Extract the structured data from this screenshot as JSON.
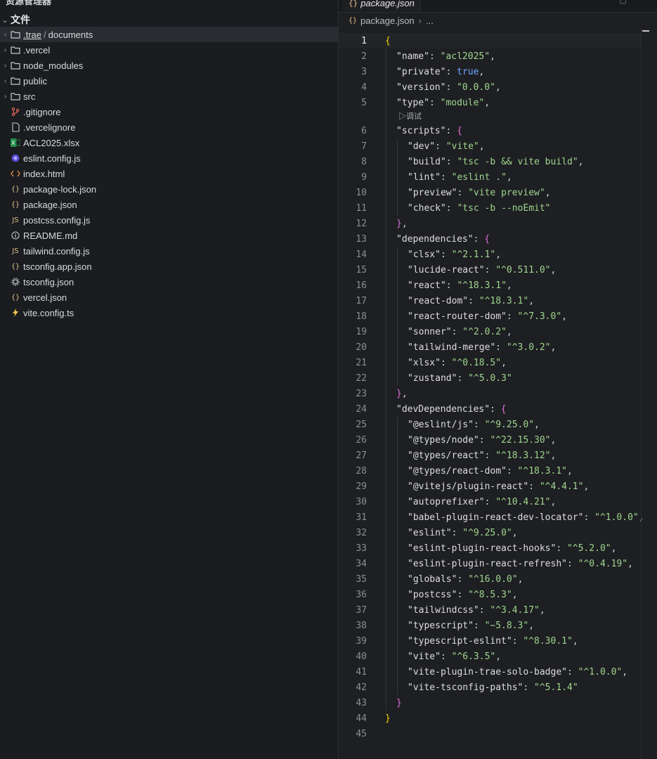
{
  "sidebar": {
    "header": "资源管理器",
    "section_label": "文件",
    "items": [
      {
        "kind": "folder",
        "name": ".trae",
        "sub": "documents",
        "icon": "folder-icon",
        "selected": true
      },
      {
        "kind": "folder",
        "name": ".vercel",
        "icon": "folder-icon"
      },
      {
        "kind": "folder",
        "name": "node_modules",
        "icon": "folder-icon"
      },
      {
        "kind": "folder",
        "name": "public",
        "icon": "folder-icon"
      },
      {
        "kind": "folder",
        "name": "src",
        "icon": "folder-icon"
      },
      {
        "kind": "file",
        "name": ".gitignore",
        "icon": "git-icon"
      },
      {
        "kind": "file",
        "name": ".vercelignore",
        "icon": "file-icon"
      },
      {
        "kind": "file",
        "name": "ACL2025.xlsx",
        "icon": "excel-icon"
      },
      {
        "kind": "file",
        "name": "eslint.config.js",
        "icon": "eslint-icon"
      },
      {
        "kind": "file",
        "name": "index.html",
        "icon": "html-icon"
      },
      {
        "kind": "file",
        "name": "package-lock.json",
        "icon": "json-icon"
      },
      {
        "kind": "file",
        "name": "package.json",
        "icon": "json-icon"
      },
      {
        "kind": "file",
        "name": "postcss.config.js",
        "icon": "js-icon"
      },
      {
        "kind": "file",
        "name": "README.md",
        "icon": "info-icon"
      },
      {
        "kind": "file",
        "name": "tailwind.config.js",
        "icon": "js-icon"
      },
      {
        "kind": "file",
        "name": "tsconfig.app.json",
        "icon": "json-icon"
      },
      {
        "kind": "file",
        "name": "tsconfig.json",
        "icon": "gear-icon"
      },
      {
        "kind": "file",
        "name": "vercel.json",
        "icon": "json-icon"
      },
      {
        "kind": "file",
        "name": "vite.config.ts",
        "icon": "vite-icon"
      }
    ]
  },
  "editor": {
    "tab_label": "package.json",
    "breadcrumb": {
      "file": "package.json",
      "rest": "..."
    },
    "codelens": "▷调试",
    "current_line": 1,
    "lines": [
      {
        "n": "1",
        "tokens": [
          [
            "b1",
            "{"
          ]
        ],
        "indent": 0
      },
      {
        "n": "2",
        "tokens": [
          [
            "k",
            "\"name\""
          ],
          [
            "p",
            ": "
          ],
          [
            "s",
            "\"acl2025\""
          ],
          [
            "p",
            ","
          ]
        ],
        "indent": 1
      },
      {
        "n": "3",
        "tokens": [
          [
            "k",
            "\"private\""
          ],
          [
            "p",
            ": "
          ],
          [
            "lit",
            "true"
          ],
          [
            "p",
            ","
          ]
        ],
        "indent": 1
      },
      {
        "n": "4",
        "tokens": [
          [
            "k",
            "\"version\""
          ],
          [
            "p",
            ": "
          ],
          [
            "s",
            "\"0.0.0\""
          ],
          [
            "p",
            ","
          ]
        ],
        "indent": 1
      },
      {
        "n": "5",
        "tokens": [
          [
            "k",
            "\"type\""
          ],
          [
            "p",
            ": "
          ],
          [
            "s",
            "\"module\""
          ],
          [
            "p",
            ","
          ]
        ],
        "indent": 1
      },
      {
        "n": "6",
        "tokens": [
          [
            "k",
            "\"scripts\""
          ],
          [
            "p",
            ": "
          ],
          [
            "b2",
            "{"
          ]
        ],
        "indent": 1
      },
      {
        "n": "7",
        "tokens": [
          [
            "k",
            "\"dev\""
          ],
          [
            "p",
            ": "
          ],
          [
            "s",
            "\"vite\""
          ],
          [
            "p",
            ","
          ]
        ],
        "indent": 2
      },
      {
        "n": "8",
        "tokens": [
          [
            "k",
            "\"build\""
          ],
          [
            "p",
            ": "
          ],
          [
            "s",
            "\"tsc -b && vite build\""
          ],
          [
            "p",
            ","
          ]
        ],
        "indent": 2
      },
      {
        "n": "9",
        "tokens": [
          [
            "k",
            "\"lint\""
          ],
          [
            "p",
            ": "
          ],
          [
            "s",
            "\"eslint .\""
          ],
          [
            "p",
            ","
          ]
        ],
        "indent": 2
      },
      {
        "n": "10",
        "tokens": [
          [
            "k",
            "\"preview\""
          ],
          [
            "p",
            ": "
          ],
          [
            "s",
            "\"vite preview\""
          ],
          [
            "p",
            ","
          ]
        ],
        "indent": 2
      },
      {
        "n": "11",
        "tokens": [
          [
            "k",
            "\"check\""
          ],
          [
            "p",
            ": "
          ],
          [
            "s",
            "\"tsc -b --noEmit\""
          ]
        ],
        "indent": 2
      },
      {
        "n": "12",
        "tokens": [
          [
            "b2",
            "}"
          ],
          [
            "p",
            ","
          ]
        ],
        "indent": 1
      },
      {
        "n": "13",
        "tokens": [
          [
            "k",
            "\"dependencies\""
          ],
          [
            "p",
            ": "
          ],
          [
            "b2",
            "{"
          ]
        ],
        "indent": 1
      },
      {
        "n": "14",
        "tokens": [
          [
            "k",
            "\"clsx\""
          ],
          [
            "p",
            ": "
          ],
          [
            "s",
            "\"^2.1.1\""
          ],
          [
            "p",
            ","
          ]
        ],
        "indent": 2
      },
      {
        "n": "15",
        "tokens": [
          [
            "k",
            "\"lucide-react\""
          ],
          [
            "p",
            ": "
          ],
          [
            "s",
            "\"^0.511.0\""
          ],
          [
            "p",
            ","
          ]
        ],
        "indent": 2
      },
      {
        "n": "16",
        "tokens": [
          [
            "k",
            "\"react\""
          ],
          [
            "p",
            ": "
          ],
          [
            "s",
            "\"^18.3.1\""
          ],
          [
            "p",
            ","
          ]
        ],
        "indent": 2
      },
      {
        "n": "17",
        "tokens": [
          [
            "k",
            "\"react-dom\""
          ],
          [
            "p",
            ": "
          ],
          [
            "s",
            "\"^18.3.1\""
          ],
          [
            "p",
            ","
          ]
        ],
        "indent": 2
      },
      {
        "n": "18",
        "tokens": [
          [
            "k",
            "\"react-router-dom\""
          ],
          [
            "p",
            ": "
          ],
          [
            "s",
            "\"^7.3.0\""
          ],
          [
            "p",
            ","
          ]
        ],
        "indent": 2
      },
      {
        "n": "19",
        "tokens": [
          [
            "k",
            "\"sonner\""
          ],
          [
            "p",
            ": "
          ],
          [
            "s",
            "\"^2.0.2\""
          ],
          [
            "p",
            ","
          ]
        ],
        "indent": 2
      },
      {
        "n": "20",
        "tokens": [
          [
            "k",
            "\"tailwind-merge\""
          ],
          [
            "p",
            ": "
          ],
          [
            "s",
            "\"^3.0.2\""
          ],
          [
            "p",
            ","
          ]
        ],
        "indent": 2
      },
      {
        "n": "21",
        "tokens": [
          [
            "k",
            "\"xlsx\""
          ],
          [
            "p",
            ": "
          ],
          [
            "s",
            "\"^0.18.5\""
          ],
          [
            "p",
            ","
          ]
        ],
        "indent": 2
      },
      {
        "n": "22",
        "tokens": [
          [
            "k",
            "\"zustand\""
          ],
          [
            "p",
            ": "
          ],
          [
            "s",
            "\"^5.0.3\""
          ]
        ],
        "indent": 2
      },
      {
        "n": "23",
        "tokens": [
          [
            "b2",
            "}"
          ],
          [
            "p",
            ","
          ]
        ],
        "indent": 1
      },
      {
        "n": "24",
        "tokens": [
          [
            "k",
            "\"devDependencies\""
          ],
          [
            "p",
            ": "
          ],
          [
            "b2",
            "{"
          ]
        ],
        "indent": 1
      },
      {
        "n": "25",
        "tokens": [
          [
            "k",
            "\"@eslint/js\""
          ],
          [
            "p",
            ": "
          ],
          [
            "s",
            "\"^9.25.0\""
          ],
          [
            "p",
            ","
          ]
        ],
        "indent": 2
      },
      {
        "n": "26",
        "tokens": [
          [
            "k",
            "\"@types/node\""
          ],
          [
            "p",
            ": "
          ],
          [
            "s",
            "\"^22.15.30\""
          ],
          [
            "p",
            ","
          ]
        ],
        "indent": 2
      },
      {
        "n": "27",
        "tokens": [
          [
            "k",
            "\"@types/react\""
          ],
          [
            "p",
            ": "
          ],
          [
            "s",
            "\"^18.3.12\""
          ],
          [
            "p",
            ","
          ]
        ],
        "indent": 2
      },
      {
        "n": "28",
        "tokens": [
          [
            "k",
            "\"@types/react-dom\""
          ],
          [
            "p",
            ": "
          ],
          [
            "s",
            "\"^18.3.1\""
          ],
          [
            "p",
            ","
          ]
        ],
        "indent": 2
      },
      {
        "n": "29",
        "tokens": [
          [
            "k",
            "\"@vitejs/plugin-react\""
          ],
          [
            "p",
            ": "
          ],
          [
            "s",
            "\"^4.4.1\""
          ],
          [
            "p",
            ","
          ]
        ],
        "indent": 2
      },
      {
        "n": "30",
        "tokens": [
          [
            "k",
            "\"autoprefixer\""
          ],
          [
            "p",
            ": "
          ],
          [
            "s",
            "\"^10.4.21\""
          ],
          [
            "p",
            ","
          ]
        ],
        "indent": 2
      },
      {
        "n": "31",
        "tokens": [
          [
            "k",
            "\"babel-plugin-react-dev-locator\""
          ],
          [
            "p",
            ": "
          ],
          [
            "s",
            "\"^1.0.0\""
          ],
          [
            "p",
            ","
          ]
        ],
        "indent": 2
      },
      {
        "n": "32",
        "tokens": [
          [
            "k",
            "\"eslint\""
          ],
          [
            "p",
            ": "
          ],
          [
            "s",
            "\"^9.25.0\""
          ],
          [
            "p",
            ","
          ]
        ],
        "indent": 2
      },
      {
        "n": "33",
        "tokens": [
          [
            "k",
            "\"eslint-plugin-react-hooks\""
          ],
          [
            "p",
            ": "
          ],
          [
            "s",
            "\"^5.2.0\""
          ],
          [
            "p",
            ","
          ]
        ],
        "indent": 2
      },
      {
        "n": "34",
        "tokens": [
          [
            "k",
            "\"eslint-plugin-react-refresh\""
          ],
          [
            "p",
            ": "
          ],
          [
            "s",
            "\"^0.4.19\""
          ],
          [
            "p",
            ","
          ]
        ],
        "indent": 2
      },
      {
        "n": "35",
        "tokens": [
          [
            "k",
            "\"globals\""
          ],
          [
            "p",
            ": "
          ],
          [
            "s",
            "\"^16.0.0\""
          ],
          [
            "p",
            ","
          ]
        ],
        "indent": 2
      },
      {
        "n": "36",
        "tokens": [
          [
            "k",
            "\"postcss\""
          ],
          [
            "p",
            ": "
          ],
          [
            "s",
            "\"^8.5.3\""
          ],
          [
            "p",
            ","
          ]
        ],
        "indent": 2
      },
      {
        "n": "37",
        "tokens": [
          [
            "k",
            "\"tailwindcss\""
          ],
          [
            "p",
            ": "
          ],
          [
            "s",
            "\"^3.4.17\""
          ],
          [
            "p",
            ","
          ]
        ],
        "indent": 2
      },
      {
        "n": "38",
        "tokens": [
          [
            "k",
            "\"typescript\""
          ],
          [
            "p",
            ": "
          ],
          [
            "s",
            "\"~5.8.3\""
          ],
          [
            "p",
            ","
          ]
        ],
        "indent": 2
      },
      {
        "n": "39",
        "tokens": [
          [
            "k",
            "\"typescript-eslint\""
          ],
          [
            "p",
            ": "
          ],
          [
            "s",
            "\"^8.30.1\""
          ],
          [
            "p",
            ","
          ]
        ],
        "indent": 2
      },
      {
        "n": "40",
        "tokens": [
          [
            "k",
            "\"vite\""
          ],
          [
            "p",
            ": "
          ],
          [
            "s",
            "\"^6.3.5\""
          ],
          [
            "p",
            ","
          ]
        ],
        "indent": 2
      },
      {
        "n": "41",
        "tokens": [
          [
            "k",
            "\"vite-plugin-trae-solo-badge\""
          ],
          [
            "p",
            ": "
          ],
          [
            "s",
            "\"^1.0.0\""
          ],
          [
            "p",
            ","
          ]
        ],
        "indent": 2
      },
      {
        "n": "42",
        "tokens": [
          [
            "k",
            "\"vite-tsconfig-paths\""
          ],
          [
            "p",
            ": "
          ],
          [
            "s",
            "\"^5.1.4\""
          ]
        ],
        "indent": 2
      },
      {
        "n": "43",
        "tokens": [
          [
            "b2",
            "}"
          ]
        ],
        "indent": 1
      },
      {
        "n": "44",
        "tokens": [
          [
            "b1",
            "}"
          ]
        ],
        "indent": 0
      },
      {
        "n": "45",
        "tokens": [],
        "indent": 0
      }
    ]
  }
}
